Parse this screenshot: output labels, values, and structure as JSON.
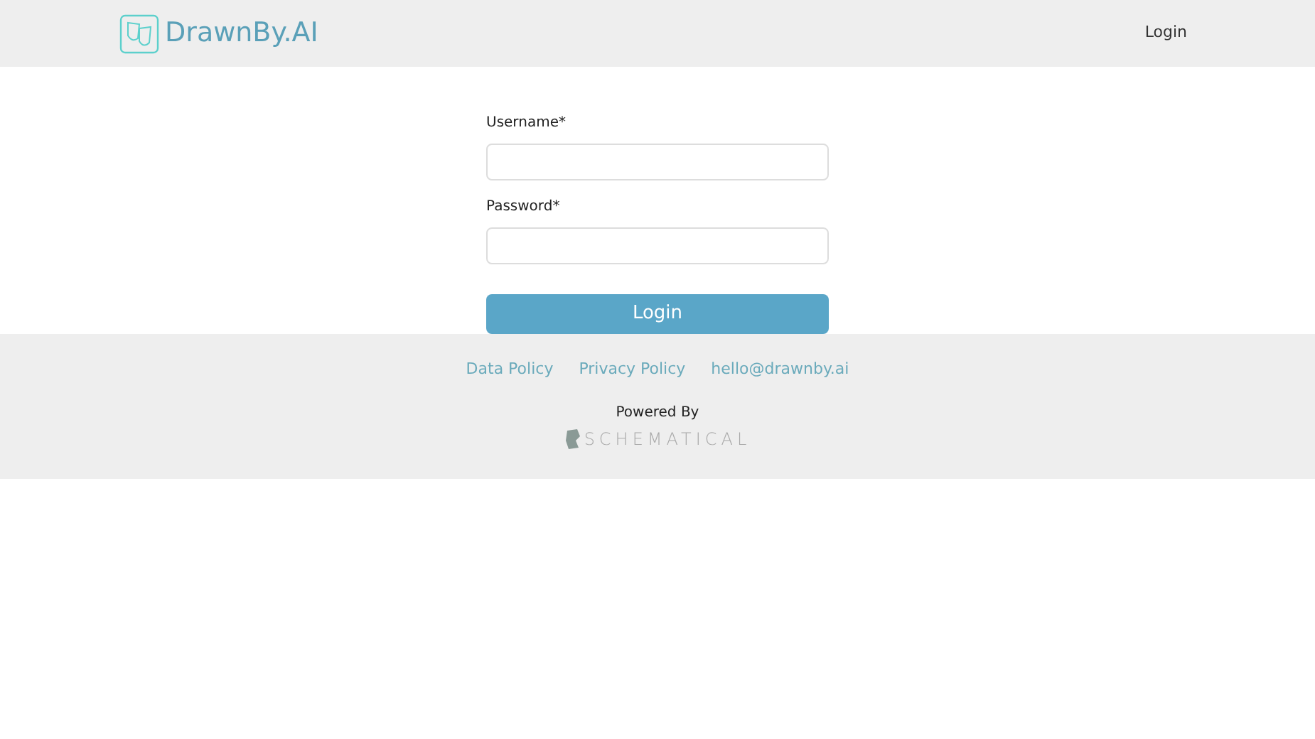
{
  "header": {
    "logo_text": "DrawnBy.AI",
    "nav_link": "Login"
  },
  "form": {
    "fields": [
      {
        "label": "Username*"
      },
      {
        "label": "Password*"
      }
    ],
    "submit": "Login"
  },
  "footer": {
    "links": [
      "Data Policy",
      "Privacy Policy",
      "hello@drawnby.ai"
    ],
    "powered_by": "Powered By",
    "brand": "SCHEMATICAL"
  }
}
